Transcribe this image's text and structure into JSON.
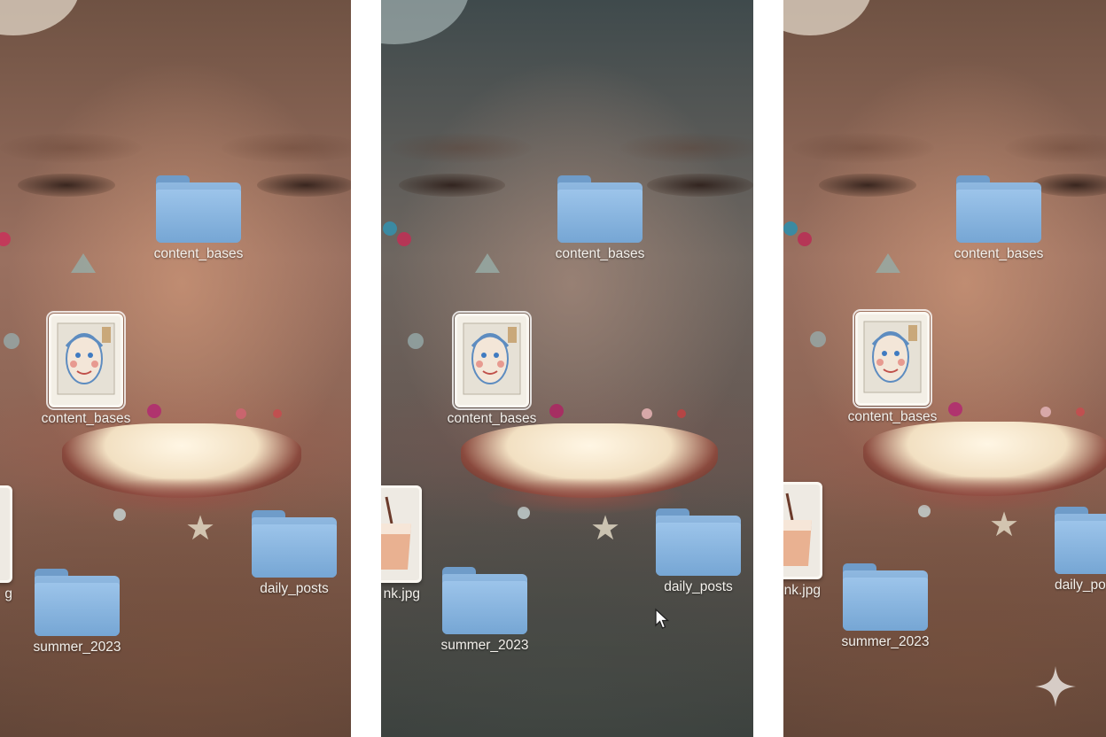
{
  "panels": [
    {
      "tone": "warm",
      "items": {
        "folder_top": "content_bases",
        "image_drawing": "content_bases",
        "image_drink": "g",
        "folder_right": "daily_posts",
        "folder_bottom": "summer_2023"
      }
    },
    {
      "tone": "cool",
      "items": {
        "folder_top": "content_bases",
        "image_drawing": "content_bases",
        "image_drink": "nk.jpg",
        "folder_right": "daily_posts",
        "folder_bottom": "summer_2023"
      }
    },
    {
      "tone": "warm",
      "items": {
        "folder_top": "content_bases",
        "image_drawing": "content_bases",
        "image_drink": "nk.jpg",
        "folder_right": "daily_po",
        "folder_bottom": "summer_2023"
      }
    }
  ],
  "icons": {
    "folder": "folder-icon",
    "cursor": "mouse-pointer-icon",
    "watermark": "sparkle-icon"
  },
  "colors": {
    "folder_blue": "#7fadda",
    "label_text": "#f4f1ec"
  }
}
